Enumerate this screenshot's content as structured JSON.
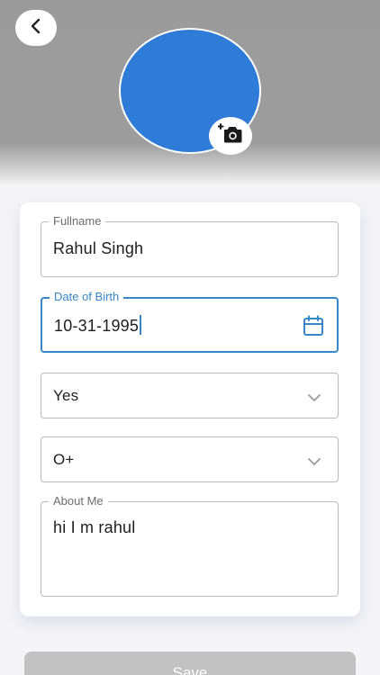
{
  "header": {
    "back_icon": "chevron-left-icon",
    "avatar_color": "#2e7bd8",
    "camera_icon": "add-camera-icon"
  },
  "form": {
    "fullname": {
      "label": "Fullname",
      "value": "Rahul Singh"
    },
    "dob": {
      "label": "Date of Birth",
      "value": "10-31-1995",
      "icon": "calendar-icon"
    },
    "select_1": {
      "value": "Yes",
      "icon": "chevron-down-icon"
    },
    "select_2": {
      "value": "O+",
      "icon": "chevron-down-icon"
    },
    "about": {
      "label": "About Me",
      "value": "hi I m rahul"
    }
  },
  "actions": {
    "save_label": "Save"
  },
  "colors": {
    "accent": "#3a87c8",
    "header_bg": "#9d9d9d",
    "save_bg": "#c2c2c2"
  }
}
